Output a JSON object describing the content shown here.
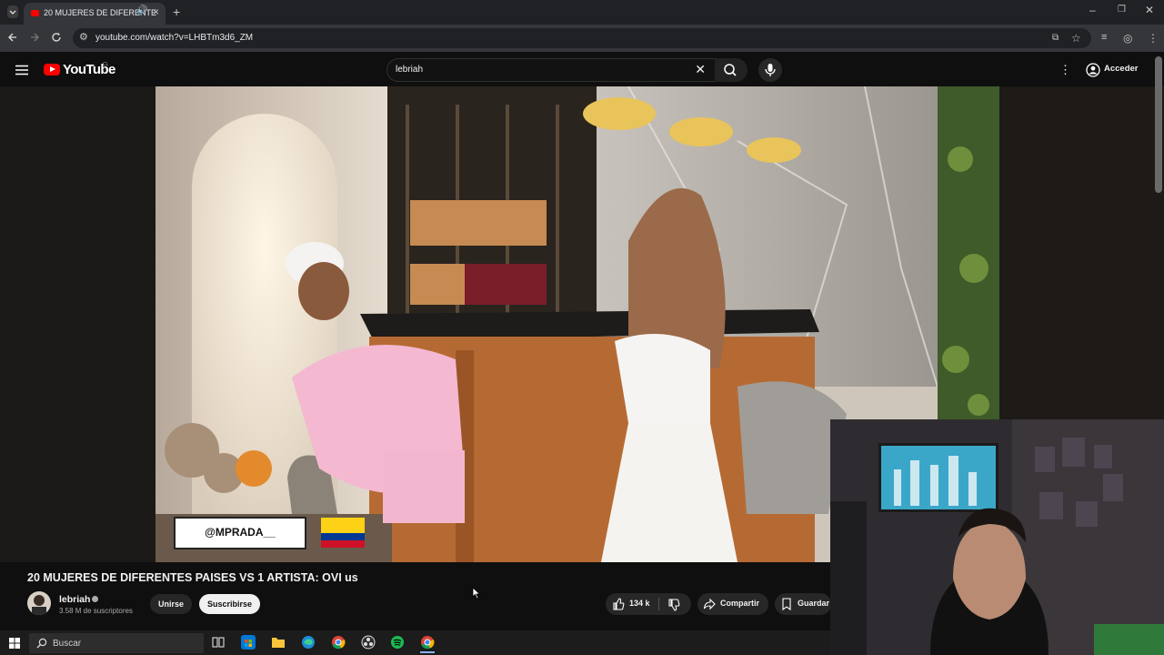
{
  "browser": {
    "tab_title": "20 MUJERES DE DIFERENTE",
    "url": "youtube.com/watch?v=LHBTm3d6_ZM"
  },
  "youtube": {
    "logo_text": "YouTube",
    "country_code": "CL",
    "search_value": "lebriah",
    "signin_label": "Acceder"
  },
  "video": {
    "overlay_handle": "@MPRADA__",
    "title": "20 MUJERES DE DIFERENTES PAISES VS 1 ARTISTA: OVI us"
  },
  "channel": {
    "name": "lebriah",
    "subscribers": "3.58 M de suscriptores",
    "join_label": "Unirse",
    "subscribe_label": "Suscribirse"
  },
  "actions": {
    "likes": "134 k",
    "share_label": "Compartir",
    "save_label": "Guardar"
  },
  "taskbar": {
    "search_placeholder": "Buscar",
    "apps": [
      "task-view-icon",
      "store-icon",
      "file-explorer-icon",
      "edge-icon",
      "chrome-icon",
      "obs-icon",
      "spotify-icon",
      "chrome-icon"
    ]
  },
  "colors": {
    "youtube_red": "#ff0000",
    "background": "#0f0f0f",
    "spotify_green": "#1db954"
  }
}
